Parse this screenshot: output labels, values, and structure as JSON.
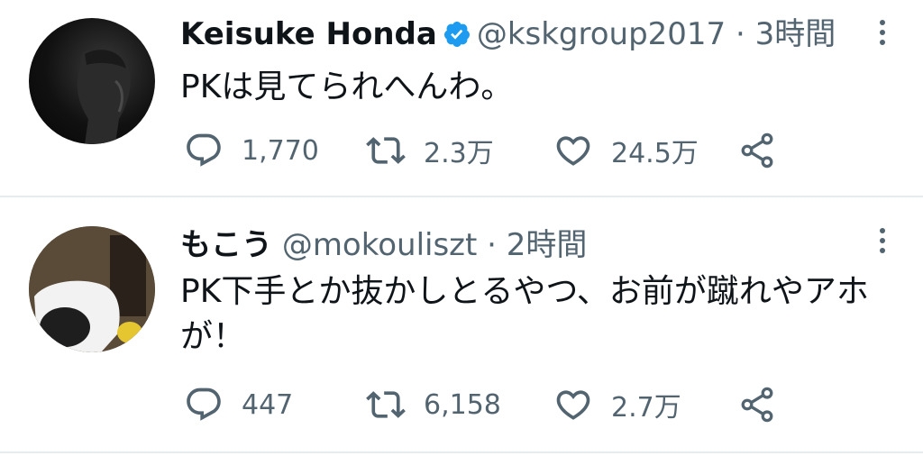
{
  "colors": {
    "text": "#0f1419",
    "secondary": "#536471",
    "verified": "#1d9bf0",
    "divider": "#e6ecf0"
  },
  "tweets": [
    {
      "name": "Keisuke Honda",
      "verified": true,
      "handle": "@kskgroup2017",
      "separator": "·",
      "time": "3時間",
      "text": "PKは見てられへんわ。",
      "replies": "1,770",
      "retweets": "2.3万",
      "likes": "24.5万"
    },
    {
      "name": "もこう",
      "verified": false,
      "handle": "@mokouliszt",
      "separator": "·",
      "time": "2時間",
      "text": "PK下手とか抜かしとるやつ、お前が蹴れやアホが！",
      "replies": "447",
      "retweets": "6,158",
      "likes": "2.7万"
    }
  ],
  "icons": [
    "reply-icon",
    "retweet-icon",
    "like-icon",
    "share-icon",
    "verified-badge-icon",
    "more-options-icon"
  ]
}
